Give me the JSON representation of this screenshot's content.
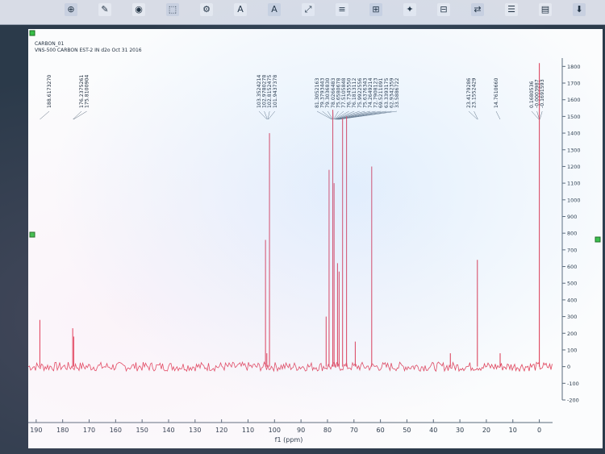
{
  "toolbar": {
    "labels": [
      "⊕",
      "✎",
      "◉",
      "⬚",
      "⚙",
      "A",
      "A",
      "⤢",
      "≡",
      "⊞",
      "✦",
      "⊟",
      "⇄",
      "☰",
      "▤",
      "⬇"
    ]
  },
  "header": {
    "line1": "CARBON_01",
    "line2": "VNS-500 CARBON EST-2 IN d2o Oct 31 2016"
  },
  "peak_labels_group1": [
    "188.6173270"
  ],
  "peak_labels_group2": [
    "176.2375261",
    "175.8100904"
  ],
  "peak_labels_group3": [
    "103.3524214",
    "102.9780278",
    "102.8152475",
    "101.9437378"
  ],
  "peak_labels_group4": [
    "81.3052163",
    "79.3793443",
    "79.3036830",
    "78.0266483",
    "75.6580678",
    "77.5105848",
    "76.7345550",
    "76.1813112",
    "75.9922556",
    "75.6376343",
    "74.2649214",
    "72.7908123",
    "69.5211091",
    "63.3393175",
    "62.9342359",
    "33.5886722"
  ],
  "peak_labels_group5": [
    "23.4179286",
    "23.1552429"
  ],
  "peak_labels_group6": [
    "14.7610660"
  ],
  "peak_labels_group7": [
    "0.1680536",
    "-0.0003987",
    "-0.1691593"
  ],
  "chart_data": {
    "type": "line",
    "title": "",
    "xlabel": "f1 (ppm)",
    "ylabel": "",
    "xlim": [
      193,
      -5
    ],
    "ylim": [
      -200,
      1850
    ],
    "x_ticks": [
      190,
      180,
      170,
      160,
      150,
      140,
      130,
      120,
      110,
      100,
      90,
      80,
      70,
      60,
      50,
      40,
      30,
      20,
      10,
      0
    ],
    "y_ticks": [
      1800,
      1700,
      1600,
      1500,
      1400,
      1300,
      1200,
      1100,
      1000,
      900,
      800,
      700,
      600,
      500,
      400,
      300,
      200,
      100,
      0,
      -100,
      -200
    ],
    "baseline": 0,
    "series": [
      {
        "color": "#e0425a",
        "peaks": [
          {
            "x": 188.6,
            "y": 280
          },
          {
            "x": 176.2,
            "y": 230
          },
          {
            "x": 175.8,
            "y": 180
          },
          {
            "x": 103.4,
            "y": 760
          },
          {
            "x": 102.9,
            "y": 80
          },
          {
            "x": 101.9,
            "y": 1400
          },
          {
            "x": 80.5,
            "y": 300
          },
          {
            "x": 79.4,
            "y": 1180
          },
          {
            "x": 78.0,
            "y": 1540
          },
          {
            "x": 77.5,
            "y": 1100
          },
          {
            "x": 76.2,
            "y": 620
          },
          {
            "x": 75.6,
            "y": 570
          },
          {
            "x": 74.3,
            "y": 1490
          },
          {
            "x": 72.8,
            "y": 1500
          },
          {
            "x": 69.5,
            "y": 150
          },
          {
            "x": 63.3,
            "y": 1200
          },
          {
            "x": 33.6,
            "y": 80
          },
          {
            "x": 23.4,
            "y": 640
          },
          {
            "x": 14.8,
            "y": 80
          },
          {
            "x": 0.0,
            "y": 1820
          }
        ]
      }
    ]
  }
}
